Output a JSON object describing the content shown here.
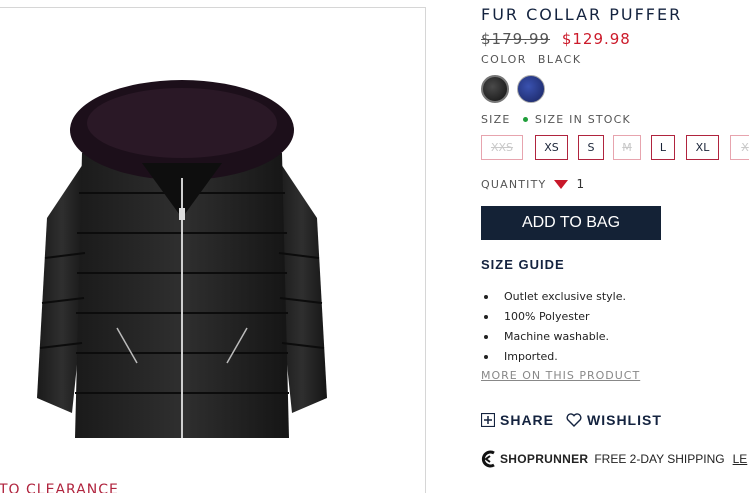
{
  "product": {
    "title": "FUR COLLAR PUFFER",
    "price_original": "$179.99",
    "price_sale": "$129.98",
    "color_label": "COLOR",
    "color_value": "BLACK",
    "swatches": [
      {
        "name": "black",
        "color": "#111111"
      },
      {
        "name": "navy",
        "color": "#233080"
      }
    ],
    "size_label": "SIZE",
    "size_stock": "SIZE IN STOCK",
    "sizes": [
      {
        "label": "XXS",
        "available": false
      },
      {
        "label": "XS",
        "available": true
      },
      {
        "label": "S",
        "available": true
      },
      {
        "label": "M",
        "available": false
      },
      {
        "label": "L",
        "available": true
      },
      {
        "label": "XL",
        "available": true
      },
      {
        "label": "X",
        "available": false
      }
    ],
    "quantity_label": "QUANTITY",
    "quantity_value": "1",
    "add_to_bag": "ADD TO BAG",
    "size_guide": "SIZE GUIDE",
    "features": [
      "Outlet exclusive style.",
      "100% Polyester",
      "Machine washable.",
      "Imported."
    ],
    "more_link": "MORE ON THIS PRODUCT",
    "share": "SHARE",
    "wishlist": "WISHLIST",
    "shoprunner_brand": "SHOPRUNNER",
    "shoprunner_text": "FREE 2-DAY SHIPPING",
    "shoprunner_link": "LE"
  },
  "left": {
    "back_link": "TO CLEARANCE"
  },
  "colors": {
    "accent_red": "#cc1b2b",
    "navy": "#142236",
    "in_stock_green": "#1f9e3a"
  }
}
